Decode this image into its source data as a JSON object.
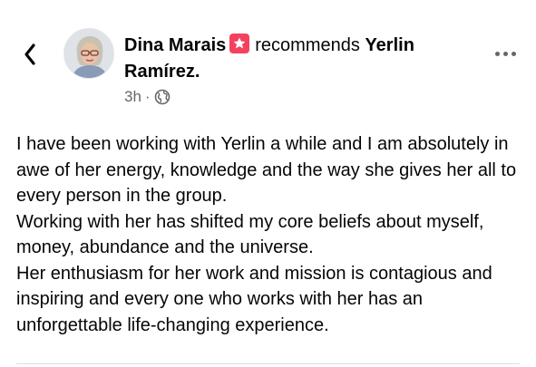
{
  "post": {
    "author": "Dina Marais",
    "action": "recommends",
    "recommended": "Yerlin Ramírez.",
    "time": "3h",
    "separator": "·",
    "privacy_icon": "globe-icon",
    "body_lines": [
      "I have been working with Yerlin a while and I am absolutely in awe of her energy, knowledge and the way she gives her all to every person in the group.",
      "Working with her has shifted my core beliefs about myself, money, abundance and the universe.",
      "Her enthusiasm for her work and mission is contagious and inspiring and every one who works with her has an unforgettable life-changing experience."
    ]
  },
  "icons": {
    "back": "chevron-left-icon",
    "recommend_badge": "star-icon",
    "more": "more-options-icon"
  },
  "colors": {
    "badge": "#f3425f",
    "meta_text": "#65676b",
    "text": "#050505"
  }
}
